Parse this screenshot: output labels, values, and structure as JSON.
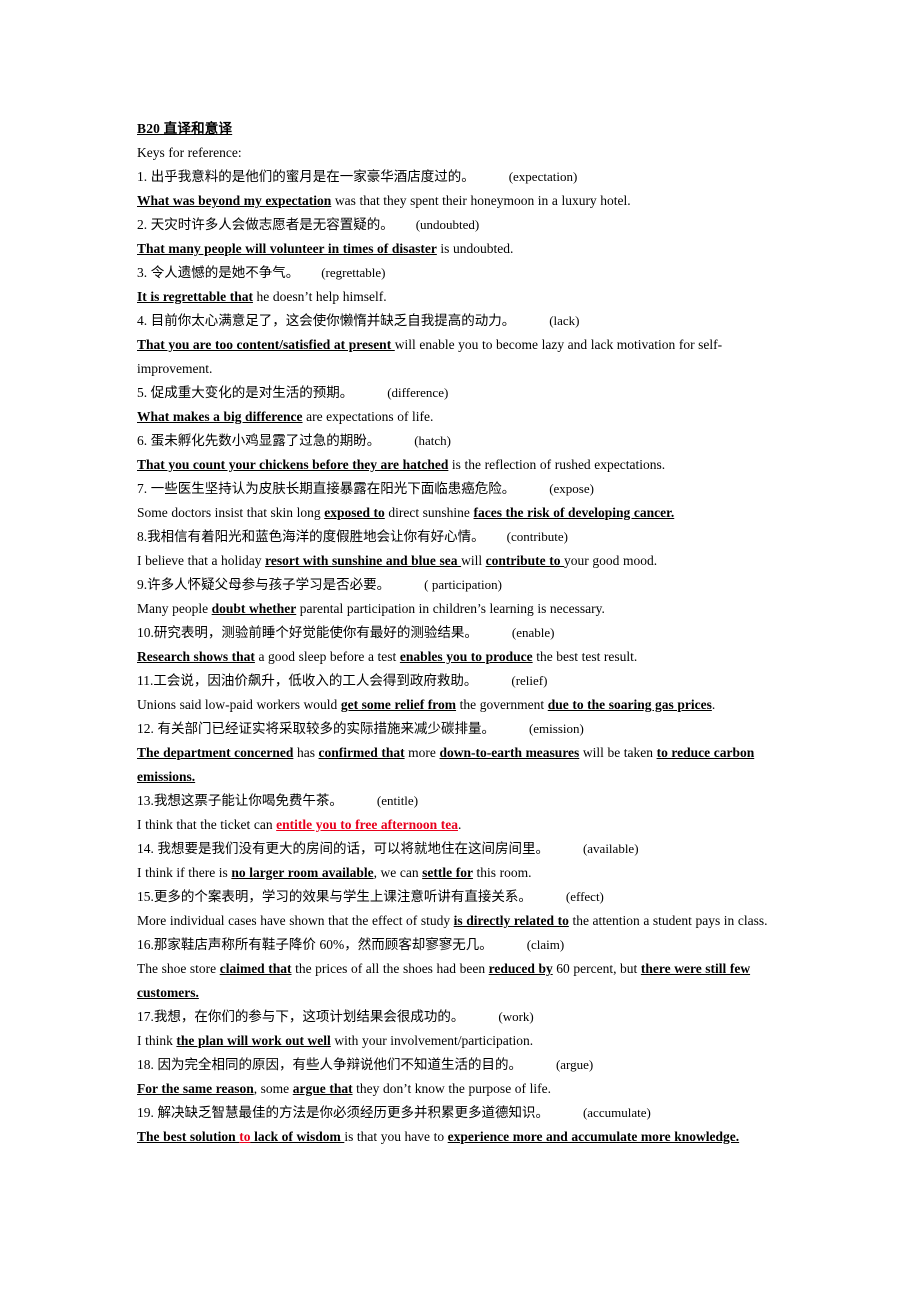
{
  "document": {
    "title": "B20  直译和意译",
    "subtitle": "Keys for reference:",
    "accent_red": "#e8001c",
    "text_color": "#000000",
    "background": "#ffffff"
  },
  "items": [
    {
      "number": "1.",
      "chinese": "出乎我意料的是他们的蜜月是在一家豪华酒店度过的。",
      "cue": "(expectation)",
      "answer_bold": "What was beyond my expectation",
      "answer_rest": " was that they spent their honeymoon in a luxury hotel."
    },
    {
      "number": "2.",
      "chinese": "天灾时许多人会做志愿者是无容置疑的。",
      "cue": "(undoubted)",
      "answer_bold": "That many people will volunteer in times of disaster",
      "answer_rest": " is undoubted."
    },
    {
      "number": "3.",
      "chinese": "令人遗憾的是她不争气。",
      "cue": "(regrettable)",
      "answer_bold": "It is regrettable that",
      "answer_rest": " he doesn’t help himself."
    },
    {
      "number": "4.",
      "chinese": "目前你太心满意足了，这会使你懒惰并缺乏自我提高的动力。",
      "cue": "(lack)",
      "answer_bold": "That you are too content/satisfied at present ",
      "answer_rest": "will enable you to become lazy and lack motivation for self-improvement."
    },
    {
      "number": "5.",
      "chinese": "促成重大变化的是对生活的预期。",
      "cue": "(difference)",
      "answer_bold": "What makes a big difference",
      "answer_rest": " are expectations of life."
    },
    {
      "number": "6.",
      "chinese": "蛋未孵化先数小鸡显露了过急的期盼。",
      "cue": "(hatch)",
      "answer_bold": "That you count your chickens before they are hatched",
      "answer_rest": " is the reflection of rushed expectations."
    },
    {
      "number": "7.",
      "chinese": "一些医生坚持认为皮肤长期直接暴露在阳光下面临患癌危险。",
      "cue": "(expose)",
      "answer_pre": "Some doctors insist that skin long ",
      "answer_b1": "exposed to",
      "answer_mid": " direct sunshine ",
      "answer_b2": "faces the risk of developing cancer."
    },
    {
      "number": "8.",
      "chinese": "我相信有着阳光和蓝色海洋的度假胜地会让你有好心情。",
      "cue": "(contribute)",
      "answer_pre": "I believe that a holiday ",
      "answer_b1": "resort with sunshine and blue sea ",
      "answer_mid": "will ",
      "answer_b2": "contribute to ",
      "answer_post": "your good mood."
    },
    {
      "number": "9.",
      "chinese": "许多人怀疑父母参与孩子学习是否必要。",
      "cue": "( participation)",
      "answer_pre": " Many people ",
      "answer_b1": "doubt whether",
      "answer_post": " parental participation in children’s learning is necessary."
    },
    {
      "number": "10.",
      "chinese": "研究表明，测验前睡个好觉能使你有最好的测验结果。",
      "cue": "(enable)",
      "answer_b1": " Research shows that",
      "answer_mid": " a good sleep before a test ",
      "answer_b2": "enables you to produce",
      "answer_post": " the best test result."
    },
    {
      "number": "11.",
      "chinese": "工会说，因油价飙升，低收入的工人会得到政府救助。",
      "cue": "(relief)",
      "answer_pre": "Unions said low-paid workers would ",
      "answer_b1": "get some relief from",
      "answer_mid": " the government ",
      "answer_b2": "due to the soaring gas prices",
      "answer_post": "."
    },
    {
      "number": "12.",
      "chinese": "有关部门已经证实将采取较多的实际措施来减少碳排量。",
      "cue": "(emission)",
      "answer_b1": "The department concerned",
      "answer_mid": " has ",
      "answer_b2": "confirmed that",
      "answer_mid2": " more ",
      "answer_b3": "down-to-earth measures",
      "answer_mid3": " will be taken ",
      "answer_b4": "to reduce carbon emissions."
    },
    {
      "number": "13.",
      "chinese": "我想这票子能让你喝免费午茶。",
      "cue": "(entitle)",
      "answer_pre": " I think that the ticket can ",
      "answer_red": "entitle you to free afternoon tea",
      "answer_post": "."
    },
    {
      "number": "14.",
      "chinese": "我想要是我们没有更大的房间的话，可以将就地住在这间房间里。",
      "cue": "(available)",
      "answer_pre": "I think if there is ",
      "answer_b1": "no larger room available",
      "answer_mid": ", we can ",
      "answer_b2": "settle for",
      "answer_post": " this room."
    },
    {
      "number": "15.",
      "chinese": "更多的个案表明，学习的效果与学生上课注意听讲有直接关系。",
      "cue": "(effect)",
      "answer_pre": "More individual cases have shown that the effect of study ",
      "answer_b1": "is directly related to",
      "answer_post": " the attention a student pays in class."
    },
    {
      "number": "16.",
      "chinese": "那家鞋店声称所有鞋子降价 60%，然而顾客却寥寥无几。",
      "cue": "(claim)",
      "answer_pre": " The shoe store ",
      "answer_b1": "claimed that",
      "answer_mid": " the prices of all the shoes had been ",
      "answer_b2": "reduced by",
      "answer_mid2": " 60 percent, but ",
      "answer_b3": "there were still few customers."
    },
    {
      "number": "17.",
      "chinese": "我想，在你们的参与下，这项计划结果会很成功的。",
      "cue": "(work)",
      "answer_pre": " I think ",
      "answer_b1": "the plan will work out well",
      "answer_post": " with your involvement/participation."
    },
    {
      "number": "18.",
      "chinese": "因为完全相同的原因，有些人争辩说他们不知道生活的目的。",
      "cue": "(argue)",
      "answer_b1": "For the same reason",
      "answer_mid": ", some ",
      "answer_b2": "argue that",
      "answer_post": " they don’t know the purpose of life."
    },
    {
      "number": "19.",
      "chinese": "解决缺乏智慧最佳的方法是你必须经历更多并积累更多道德知识。",
      "cue": "(accumulate)",
      "answer_b1a": "The best solution ",
      "answer_red": "to",
      "answer_b1b": " lack of wisdom ",
      "answer_mid": "is that you have to ",
      "answer_b2": "experience more and accumulate more knowledge."
    }
  ]
}
